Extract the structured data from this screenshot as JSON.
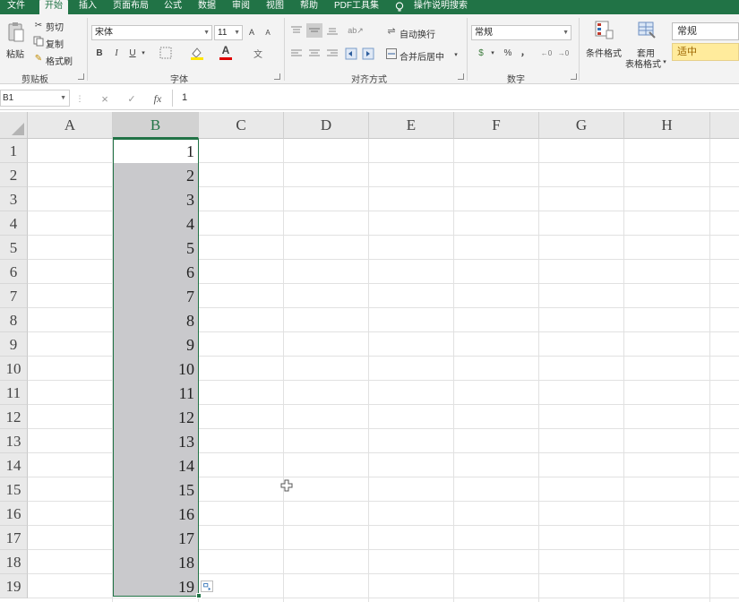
{
  "menu": {
    "file": "文件",
    "home": "开始",
    "insert": "插入",
    "page_layout": "页面布局",
    "formulas": "公式",
    "data": "数据",
    "review": "审阅",
    "view": "视图",
    "help": "帮助",
    "pdf_tools": "PDF工具集",
    "tell_me": "操作说明搜索"
  },
  "ribbon": {
    "clipboard": {
      "paste": "粘贴",
      "cut": "剪切",
      "copy": "复制",
      "format_painter": "格式刷",
      "group": "剪贴板"
    },
    "font": {
      "name": "宋体",
      "size": "11",
      "bold": "B",
      "italic": "I",
      "underline": "U",
      "font_color_glyph": "A",
      "increase": "A",
      "decrease": "A",
      "group": "字体"
    },
    "alignment": {
      "wrap_text": "自动换行",
      "merge_center": "合并后居中",
      "group": "对齐方式"
    },
    "number": {
      "format": "常规",
      "percent": "%",
      "comma": "，",
      "group": "数字"
    },
    "styles": {
      "conditional": "条件格式",
      "table_line1": "套用",
      "table_line2": "表格格式",
      "normal": "常规",
      "neutral": "适中"
    }
  },
  "formula_bar": {
    "name_box": "B1",
    "fx": "fx",
    "cancel": "×",
    "enter": "✓",
    "value": "1"
  },
  "grid": {
    "columns": [
      "A",
      "B",
      "C",
      "D",
      "E",
      "F",
      "G",
      "H"
    ],
    "rows": [
      "1",
      "2",
      "3",
      "4",
      "5",
      "6",
      "7",
      "8",
      "9",
      "10",
      "11",
      "12",
      "13",
      "14",
      "15",
      "16",
      "17",
      "18",
      "19"
    ],
    "values_b": [
      "1",
      "2",
      "3",
      "4",
      "5",
      "6",
      "7",
      "8",
      "9",
      "10",
      "11",
      "12",
      "13",
      "14",
      "15",
      "16",
      "17",
      "18",
      "19"
    ]
  },
  "colors": {
    "accent": "#217346",
    "selection": "#c9c9cc",
    "neutral_style": "#ffeb9c"
  }
}
